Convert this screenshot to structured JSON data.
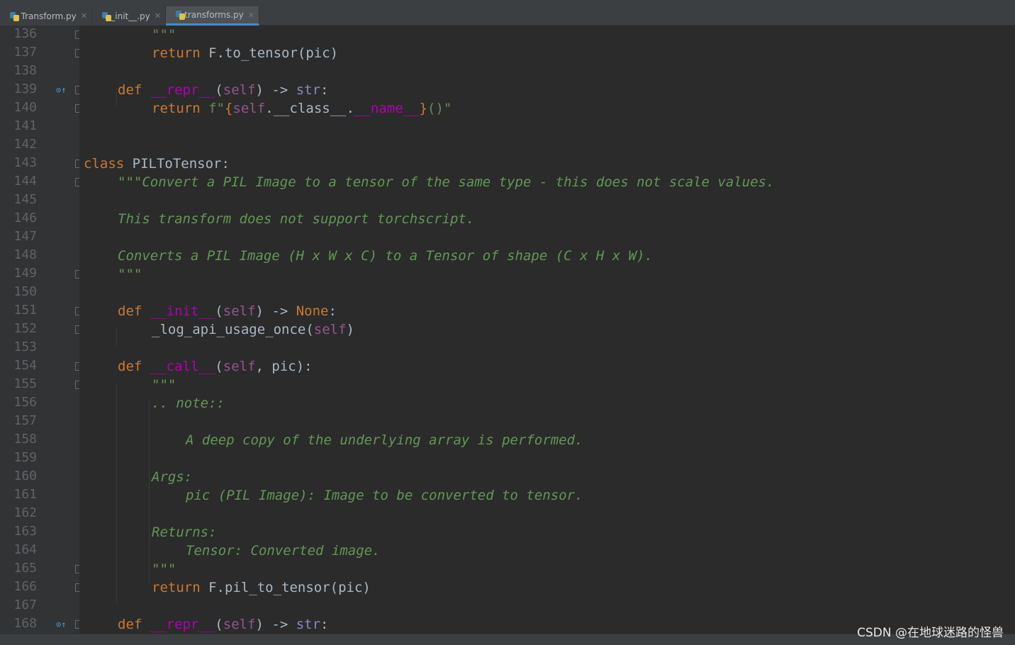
{
  "tabs": [
    {
      "label": "Transform.py",
      "active": false
    },
    {
      "label": "__init__.py",
      "active": false
    },
    {
      "label": "transforms.py",
      "active": true
    }
  ],
  "line_numbers": [
    "136",
    "137",
    "138",
    "139",
    "140",
    "141",
    "142",
    "143",
    "144",
    "145",
    "146",
    "147",
    "148",
    "149",
    "150",
    "151",
    "152",
    "153",
    "154",
    "155",
    "156",
    "157",
    "158",
    "159",
    "160",
    "161",
    "162",
    "163",
    "164",
    "165",
    "166",
    "167",
    "168"
  ],
  "code": {
    "l136": "\"\"\"",
    "l137_kw": "return",
    "l137_rest": " F.to_tensor(pic)",
    "l139_kw": "def",
    "l139_name": "__repr__",
    "l139_open": "(",
    "l139_self": "self",
    "l139_rest": ") -> ",
    "l139_type": "str",
    "l139_colon": ":",
    "l140_kw": "return",
    "l140_f": " f\"",
    "l140_b1": "{",
    "l140_self": "self",
    "l140_cls": ".__class__.",
    "l140_name": "__name__",
    "l140_b2": "}",
    "l140_end": "()\"",
    "l143_kw": "class",
    "l143_name": " PILToTensor:",
    "l144": "\"\"\"Convert a PIL Image to a tensor of the same type - this does not scale values.",
    "l146": "This transform does not support torchscript.",
    "l148": "Converts a PIL Image (H x W x C) to a Tensor of shape (C x H x W).",
    "l149": "\"\"\"",
    "l151_kw": "def",
    "l151_name": "__init__",
    "l151_open": "(",
    "l151_self": "self",
    "l151_rest": ") -> ",
    "l151_none": "None",
    "l151_colon": ":",
    "l152_call": "_log_api_usage_once(",
    "l152_self": "self",
    "l152_close": ")",
    "l154_kw": "def",
    "l154_name": "__call__",
    "l154_open": "(",
    "l154_self": "self",
    "l154_rest": ", pic):",
    "l155": "\"\"\"",
    "l156": ".. note::",
    "l158": "A deep copy of the underlying array is performed.",
    "l160": "Args:",
    "l161": "pic (PIL Image): Image to be converted to tensor.",
    "l163": "Returns:",
    "l164": "Tensor: Converted image.",
    "l165": "\"\"\"",
    "l166_kw": "return",
    "l166_rest": " F.pil_to_tensor(pic)",
    "l168_kw": "def",
    "l168_name": "__repr__",
    "l168_open": "(",
    "l168_self": "self",
    "l168_rest": ") -> ",
    "l168_type": "str",
    "l168_colon": ":"
  },
  "watermark": "CSDN @在地球迷路的怪兽",
  "colors": {
    "background": "#2b2b2b",
    "keyword": "#cc7832",
    "magic": "#b200b2",
    "self": "#94558d",
    "docstring": "#629755",
    "text": "#a9b7c6"
  }
}
